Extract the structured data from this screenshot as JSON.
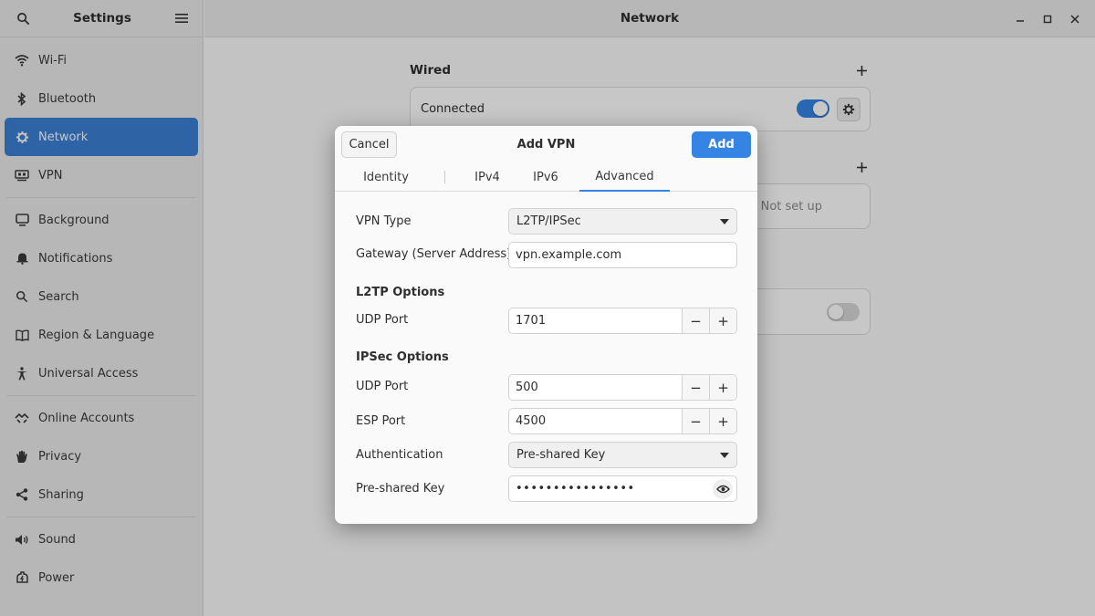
{
  "sidebar": {
    "title": "Settings",
    "items": [
      {
        "label": "Wi-Fi",
        "icon": "wifi-icon"
      },
      {
        "label": "Bluetooth",
        "icon": "bluetooth-icon"
      },
      {
        "label": "Network",
        "icon": "network-icon",
        "active": true
      },
      {
        "label": "VPN",
        "icon": "vpn-icon"
      },
      {
        "label": "Background",
        "icon": "background-icon"
      },
      {
        "label": "Notifications",
        "icon": "bell-icon"
      },
      {
        "label": "Search",
        "icon": "search-icon"
      },
      {
        "label": "Region & Language",
        "icon": "book-icon"
      },
      {
        "label": "Universal Access",
        "icon": "accessibility-icon"
      },
      {
        "label": "Online Accounts",
        "icon": "online-accounts-icon"
      },
      {
        "label": "Privacy",
        "icon": "hand-icon"
      },
      {
        "label": "Sharing",
        "icon": "share-icon"
      },
      {
        "label": "Sound",
        "icon": "speaker-icon"
      },
      {
        "label": "Power",
        "icon": "power-icon"
      }
    ]
  },
  "main": {
    "title": "Network",
    "wired": {
      "title": "Wired",
      "status": "Connected",
      "enabled": true
    },
    "vpn_card": {
      "status": "Not set up"
    },
    "proxy_card": {
      "enabled": false
    }
  },
  "dialog": {
    "title": "Add VPN",
    "cancel_label": "Cancel",
    "add_label": "Add",
    "tabs": [
      "Identity",
      "IPv4",
      "IPv6",
      "Advanced"
    ],
    "active_tab": "Advanced",
    "vpn_type": {
      "label": "VPN Type",
      "value": "L2TP/IPSec"
    },
    "gateway": {
      "label": "Gateway (Server Address)",
      "value": "vpn.example.com"
    },
    "l2tp": {
      "heading": "L2TP Options",
      "udp_label": "UDP Port",
      "udp_value": "1701"
    },
    "ipsec": {
      "heading": "IPSec Options",
      "udp_label": "UDP Port",
      "udp_value": "500",
      "esp_label": "ESP Port",
      "esp_value": "4500",
      "auth_label": "Authentication",
      "auth_value": "Pre-shared Key",
      "psk_label": "Pre-shared Key",
      "psk_value": "••••••••••••••••"
    },
    "minus": "−",
    "plus": "+"
  },
  "colors": {
    "accent": "#3584e4",
    "sidebar_active": "#3c7fd4"
  }
}
